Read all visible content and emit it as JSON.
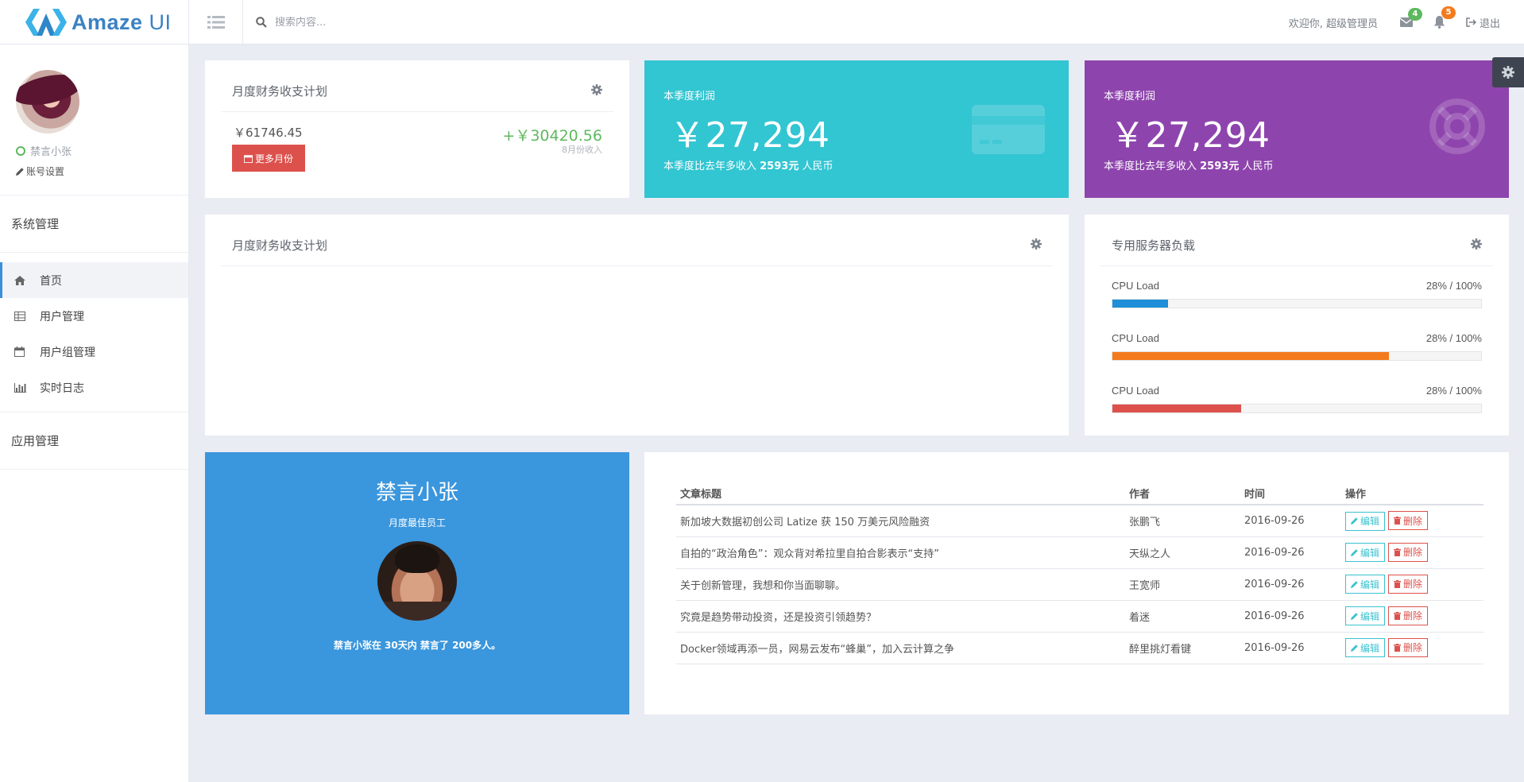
{
  "brand": {
    "name_bold": "Amaze",
    "name_light": " UI"
  },
  "search": {
    "placeholder": "搜索内容..."
  },
  "header": {
    "welcome": "欢迎你, 超级管理员",
    "mail_count": "4",
    "notice_count": "5",
    "logout": "退出"
  },
  "sidebar": {
    "user_name": "禁言小张",
    "account_settings": "账号设置",
    "group1": "系统管理",
    "items": [
      {
        "label": "首页",
        "icon": "home-icon"
      },
      {
        "label": "用户管理",
        "icon": "table-icon"
      },
      {
        "label": "用户组管理",
        "icon": "calendar-icon"
      },
      {
        "label": "实时日志",
        "icon": "bar-chart-icon"
      }
    ],
    "group2": "应用管理"
  },
  "finance": {
    "title": "月度财务收支计划",
    "left_amount": "￥61746.45",
    "more_button": "更多月份",
    "right_amount": "+￥30420.56",
    "right_sub": "8月份收入"
  },
  "tiles": [
    {
      "label": "本季度利润",
      "value": "￥27,294",
      "sub_pre": "本季度比去年多收入 ",
      "sub_bold": "2593元",
      "sub_post": " 人民币",
      "color": "#32c5d2"
    },
    {
      "label": "本季度利润",
      "value": "￥27,294",
      "sub_pre": "本季度比去年多收入 ",
      "sub_bold": "2593元",
      "sub_post": " 人民币",
      "color": "#8e44ad"
    }
  ],
  "finance_chart": {
    "title": "月度财务收支计划"
  },
  "server": {
    "title": "专用服务器负载",
    "rows": [
      {
        "label": "CPU Load",
        "value": "28% / 100%",
        "fill": 0.15,
        "color": "#1e8fd8"
      },
      {
        "label": "CPU Load",
        "value": "28% / 100%",
        "fill": 0.75,
        "color": "#f37b1d"
      },
      {
        "label": "CPU Load",
        "value": "28% / 100%",
        "fill": 0.35,
        "color": "#dd514c"
      }
    ]
  },
  "employee": {
    "name": "禁言小张",
    "title": "月度最佳员工",
    "desc": "禁言小张在 30天内 禁言了 200多人。"
  },
  "articles": {
    "headers": [
      "文章标题",
      "作者",
      "时间",
      "操作"
    ],
    "edit_label": "编辑",
    "delete_label": "删除",
    "rows": [
      {
        "title": "新加坡大数据初创公司 Latize 获 150 万美元风险融资",
        "author": "张鹏飞",
        "date": "2016-09-26"
      },
      {
        "title": "自拍的“政治角色”：观众背对希拉里自拍合影表示“支持”",
        "author": "天纵之人",
        "date": "2016-09-26"
      },
      {
        "title": "关于创新管理，我想和你当面聊聊。",
        "author": "王宽师",
        "date": "2016-09-26"
      },
      {
        "title": "究竟是趋势带动投资，还是投资引领趋势？",
        "author": "着迷",
        "date": "2016-09-26"
      },
      {
        "title": "Docker领域再添一员，网易云发布“蜂巢”，加入云计算之争",
        "author": "醉里挑灯看键",
        "date": "2016-09-26"
      }
    ]
  }
}
